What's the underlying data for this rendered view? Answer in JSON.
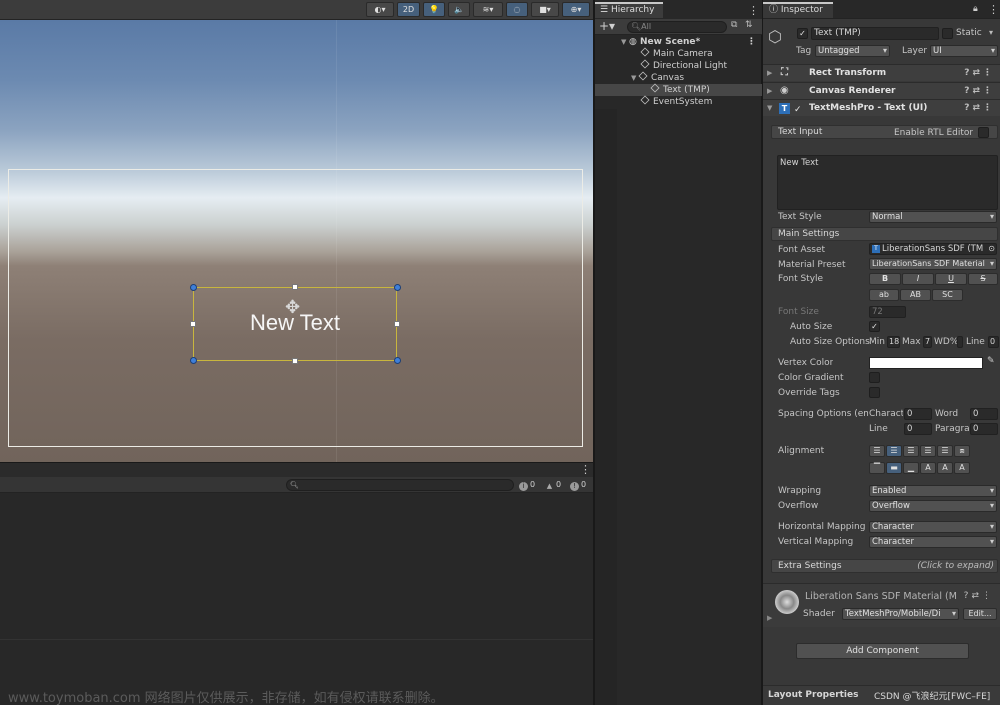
{
  "scene": {
    "mode_2d": "2D",
    "new_text": "New Text"
  },
  "console": {
    "search_placeholder": "",
    "info_count": "0",
    "warn_count": "0",
    "error_count": "0"
  },
  "hierarchy": {
    "tab": "Hierarchy",
    "search_placeholder": "All",
    "items": [
      {
        "label": "New Scene*"
      },
      {
        "label": "Main Camera"
      },
      {
        "label": "Directional Light"
      },
      {
        "label": "Canvas"
      },
      {
        "label": "Text (TMP)"
      },
      {
        "label": "EventSystem"
      }
    ]
  },
  "inspector": {
    "tab": "Inspector",
    "object_name": "Text (TMP)",
    "static_label": "Static",
    "tag_label": "Tag",
    "tag_value": "Untagged",
    "layer_label": "Layer",
    "layer_value": "UI",
    "components": {
      "rect_transform": "Rect Transform",
      "canvas_renderer": "Canvas Renderer",
      "tmp": "TextMeshPro - Text (UI)"
    },
    "text_input": {
      "header": "Text Input",
      "rtl_label": "Enable RTL Editor",
      "value": "New Text"
    },
    "text_style": {
      "label": "Text Style",
      "value": "Normal"
    },
    "main_settings": "Main Settings",
    "font_asset": {
      "label": "Font Asset",
      "value": "LiberationSans SDF (TM"
    },
    "material_preset": {
      "label": "Material Preset",
      "value": "LiberationSans SDF Material"
    },
    "font_style": {
      "label": "Font Style",
      "row1": [
        "B",
        "I",
        "U",
        "S"
      ],
      "row2": [
        "ab",
        "AB",
        "SC"
      ]
    },
    "font_size": {
      "label": "Font Size",
      "value": "72"
    },
    "auto_size": {
      "label": "Auto Size",
      "checked": "✓"
    },
    "auto_size_options": {
      "label": "Auto Size Options",
      "min_label": "Min",
      "min_value": "18",
      "max_label": "Max",
      "max_value": "7",
      "wd_label": "WD%",
      "line_label": "Line",
      "line_value": "0"
    },
    "vertex_color": {
      "label": "Vertex Color",
      "value": "#ffffff"
    },
    "color_gradient": {
      "label": "Color Gradient"
    },
    "override_tags": {
      "label": "Override Tags"
    },
    "spacing": {
      "label": "Spacing Options (em)",
      "character_label": "Character",
      "character_value": "0",
      "word_label": "Word",
      "word_value": "0",
      "line_label": "Line",
      "line_value": "0",
      "paragraph_label": "Paragraph",
      "paragraph_value": "0"
    },
    "alignment": {
      "label": "Alignment"
    },
    "wrapping": {
      "label": "Wrapping",
      "value": "Enabled"
    },
    "overflow": {
      "label": "Overflow",
      "value": "Overflow"
    },
    "horizontal_mapping": {
      "label": "Horizontal Mapping",
      "value": "Character"
    },
    "vertical_mapping": {
      "label": "Vertical Mapping",
      "value": "Character"
    },
    "extra_settings": {
      "label": "Extra Settings",
      "hint": "(Click to expand)"
    },
    "material": {
      "name": "Liberation Sans SDF Material (M",
      "shader_label": "Shader",
      "shader_value": "TextMeshPro/Mobile/Di",
      "edit_button": "Edit..."
    },
    "add_component": "Add Component",
    "layout_properties": "Layout Properties"
  },
  "overlay": {
    "watermark": "www.toymoban.com 网络图片仅供展示，非存储，如有侵权请联系删除。",
    "csdn_credit": "CSDN @飞浪纪元[FWC–FE]"
  },
  "colors": {
    "selection_blue": "#46607c",
    "rect_outline": "#c8b63e",
    "handle_blue": "#3f7fd8"
  }
}
